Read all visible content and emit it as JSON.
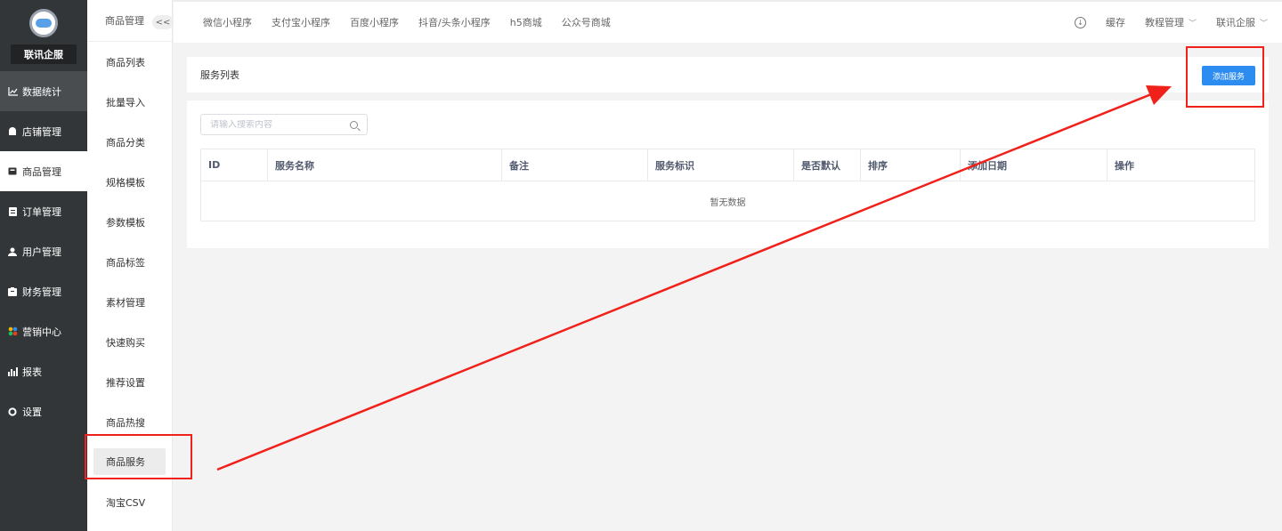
{
  "brand": {
    "name": "联讯企服"
  },
  "sidebar": {
    "items": [
      {
        "label": "数据统计",
        "icon": "line-chart-icon"
      },
      {
        "label": "店铺管理",
        "icon": "store-icon"
      },
      {
        "label": "商品管理",
        "icon": "product-icon"
      },
      {
        "label": "订单管理",
        "icon": "order-icon"
      },
      {
        "label": "用户管理",
        "icon": "user-icon"
      },
      {
        "label": "财务管理",
        "icon": "finance-icon"
      },
      {
        "label": "营销中心",
        "icon": "marketing-icon"
      },
      {
        "label": "报表",
        "icon": "report-icon"
      },
      {
        "label": "设置",
        "icon": "gear-icon"
      }
    ]
  },
  "submenu": {
    "title": "商品管理",
    "collapse": "<<",
    "items": [
      "商品列表",
      "批量导入",
      "商品分类",
      "规格模板",
      "参数模板",
      "商品标签",
      "素材管理",
      "快速购买",
      "推荐设置",
      "商品热搜",
      "商品服务",
      "淘宝CSV"
    ]
  },
  "topbar": {
    "tabs": [
      "微信小程序",
      "支付宝小程序",
      "百度小程序",
      "抖音/头条小程序",
      "h5商城",
      "公众号商城"
    ],
    "cache": "缓存",
    "tutorial": "教程管理",
    "account": "联讯企服"
  },
  "page": {
    "title": "服务列表",
    "add_button": "添加服务",
    "search_placeholder": "请输入搜索内容",
    "columns": [
      "ID",
      "服务名称",
      "备注",
      "服务标识",
      "是否默认",
      "排序",
      "添加日期",
      "操作"
    ],
    "empty_text": "暂无数据"
  }
}
